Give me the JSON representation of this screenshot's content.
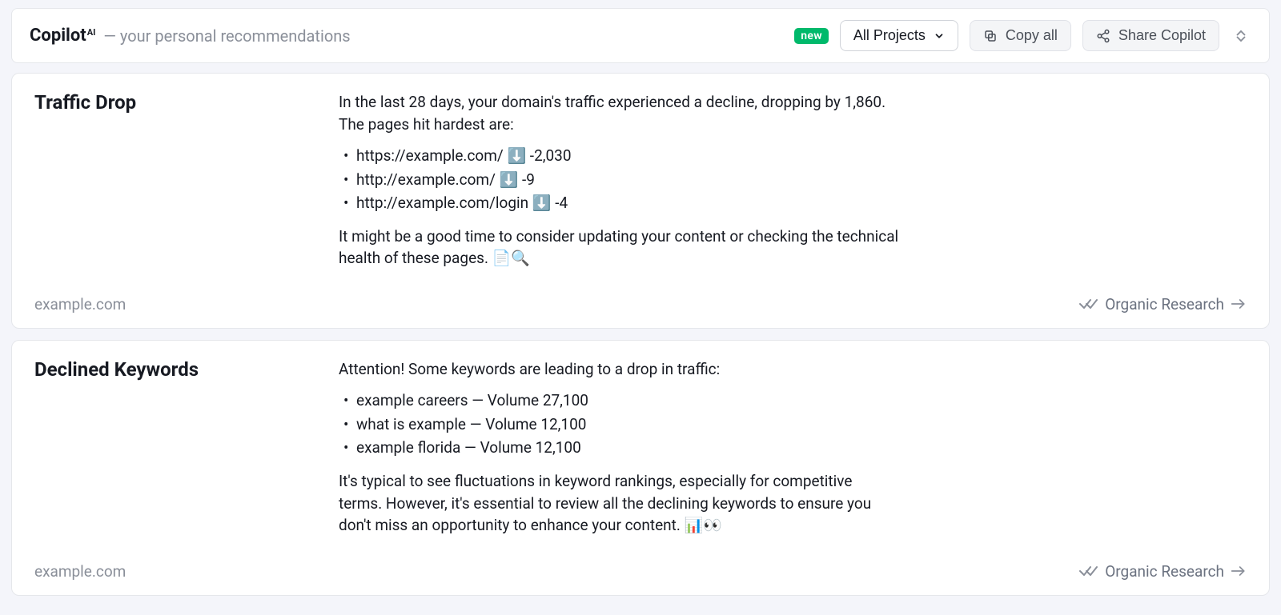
{
  "header": {
    "brand": "Copilot",
    "brand_sup": "AI",
    "subtitle": "— your personal recommendations",
    "badge": "new",
    "project_selector": "All Projects",
    "copy_all": "Copy all",
    "share": "Share Copilot"
  },
  "cards": {
    "traffic_drop": {
      "title": "Traffic Drop",
      "intro": "In the last 28 days, your domain's traffic experienced a decline, dropping by 1,860. The pages hit hardest are:",
      "items": [
        "https://example.com/ ⬇️ -2,030",
        "http://example.com/ ⬇️ -9",
        "http://example.com/login ⬇️ -4"
      ],
      "outro": "It might be a good time to consider updating your content or checking the technical health of these pages. 📄🔍",
      "domain": "example.com",
      "link": "Organic Research"
    },
    "declined_keywords": {
      "title": "Declined Keywords",
      "intro": "Attention! Some keywords are leading to a drop in traffic:",
      "items": [
        "example careers — Volume 27,100",
        "what is example — Volume 12,100",
        "example florida — Volume 12,100"
      ],
      "outro": "It's typical to see fluctuations in keyword rankings, especially for competitive terms. However, it's essential to review all the declining keywords to ensure you don't miss an opportunity to enhance your content. 📊👀",
      "domain": "example.com",
      "link": "Organic Research"
    }
  }
}
